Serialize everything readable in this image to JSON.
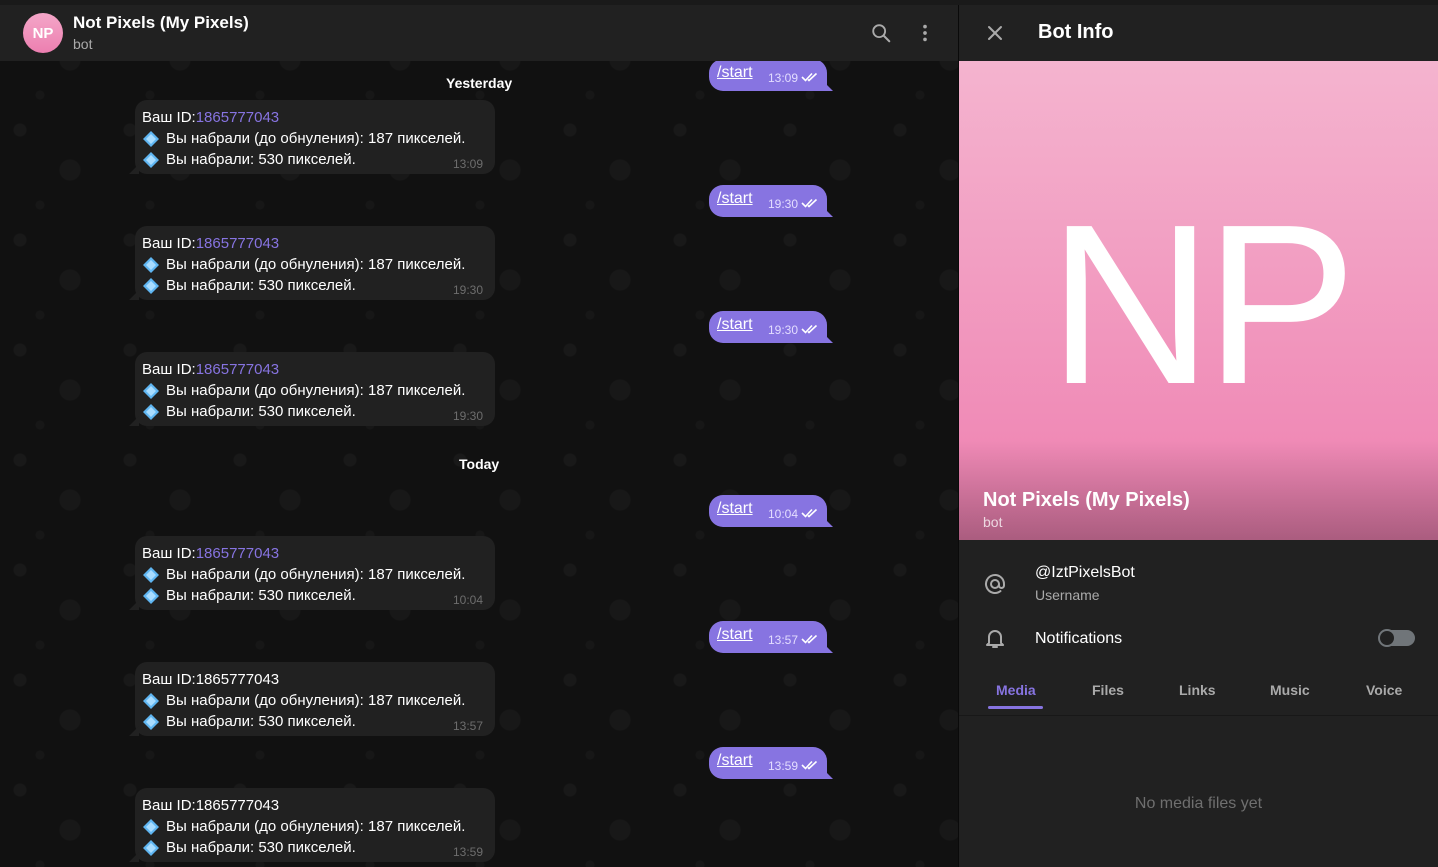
{
  "chat": {
    "avatar_initials": "NP",
    "title": "Not Pixels (My Pixels)",
    "subtitle": "bot",
    "dates": {
      "yesterday": "Yesterday",
      "today": "Today"
    },
    "incoming": [
      {
        "id_label": "Ваш ID: ",
        "id_value": "1865777043",
        "line2": "Вы набрали (до обнуления): 187 пикселей.",
        "line3": "Вы набрали: 530 пикселей.",
        "time": "13:09"
      },
      {
        "id_label": "Ваш ID: ",
        "id_value": "1865777043",
        "line2": "Вы набрали (до обнуления): 187 пикселей.",
        "line3": "Вы набрали: 530 пикселей.",
        "time": "19:30"
      },
      {
        "id_label": "Ваш ID: ",
        "id_value": "1865777043",
        "line2": "Вы набрали (до обнуления): 187 пикселей.",
        "line3": "Вы набрали: 530 пикселей.",
        "time": "19:30"
      },
      {
        "id_label": "Ваш ID: ",
        "id_value": "1865777043",
        "line2": "Вы набрали (до обнуления): 187 пикселей.",
        "line3": "Вы набрали: 530 пикселей.",
        "time": "10:04"
      },
      {
        "id_label": "Ваш ID: ",
        "id_value": "1865777043",
        "line2": "Вы набрали (до обнуления): 187 пикселей.",
        "line3": "Вы набрали: 530 пикселей.",
        "time": "13:57"
      },
      {
        "id_label": "Ваш ID: ",
        "id_value": "1865777043",
        "line2": "Вы набрали (до обнуления): 187 пикселей.",
        "line3": "Вы набрали: 530 пикселей.",
        "time": "13:59"
      }
    ],
    "outgoing": [
      {
        "text": "/start",
        "time": "13:09"
      },
      {
        "text": "/start",
        "time": "19:30"
      },
      {
        "text": "/start",
        "time": "19:30"
      },
      {
        "text": "/start",
        "time": "10:04"
      },
      {
        "text": "/start",
        "time": "13:57"
      },
      {
        "text": "/start",
        "time": "13:59"
      }
    ]
  },
  "info": {
    "title": "Bot Info",
    "hero_initials": "NP",
    "name": "Not Pixels (My Pixels)",
    "subtitle": "bot",
    "username": "@IztPixelsBot",
    "username_label": "Username",
    "notifications_label": "Notifications",
    "notifications_on": false,
    "tabs": [
      "Media",
      "Files",
      "Links",
      "Music",
      "Voice"
    ],
    "active_tab": "Media",
    "empty_text": "No media files yet"
  },
  "colors": {
    "accent": "#8774e1",
    "avatar": "#ec7fb0",
    "bubble_in": "#212121",
    "bubble_out": "#8774e1"
  },
  "icons": [
    "search-icon",
    "more-vertical-icon",
    "close-icon",
    "at-icon",
    "bell-icon",
    "diamond-icon",
    "double-check-icon"
  ]
}
